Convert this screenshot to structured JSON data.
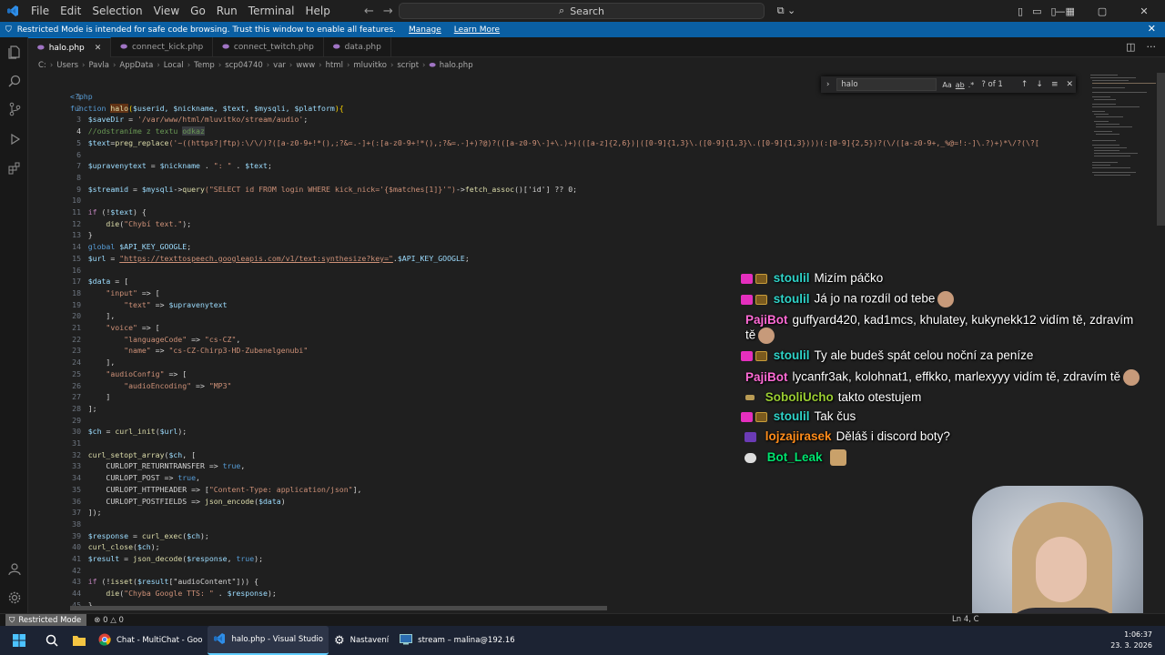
{
  "menu": [
    "File",
    "Edit",
    "Selection",
    "View",
    "Go",
    "Run",
    "Terminal",
    "Help"
  ],
  "search": {
    "label": "Search"
  },
  "banner": {
    "text": "Restricted Mode is intended for safe code browsing. Trust this window to enable all features.",
    "manage": "Manage",
    "learn_more": "Learn More"
  },
  "tabs": [
    {
      "label": "halo.php",
      "active": true
    },
    {
      "label": "connect_kick.php"
    },
    {
      "label": "connect_twitch.php"
    },
    {
      "label": "data.php"
    }
  ],
  "breadcrumb": [
    "C:",
    "Users",
    "Pavla",
    "AppData",
    "Local",
    "Temp",
    "scp04740",
    "var",
    "www",
    "html",
    "mluvitko",
    "script",
    "halo.php"
  ],
  "find": {
    "query": "halo",
    "count": "? of 1",
    "opt_case": "Aa",
    "opt_word": "ab",
    "opt_regex": ".*"
  },
  "code": {
    "l1": "<?php",
    "l2a": "function ",
    "l2b": "halo",
    "l2c": "(",
    "l2d": "$userid, $nickname, $text, $mysqli, $platform",
    "l2e": "){",
    "l3a": "    $saveDir",
    "l3b": " = ",
    "l3c": "'/var/www/html/mluvitko/stream/audio'",
    "l3d": ";",
    "l4a": "    //odstraníme z textu ",
    "l4b": "odkaz",
    "l5a": "    $text",
    "l5b": "=",
    "l5c": "preg_replace",
    "l5d": "('~((https?|ftp):\\/\\/)?([a-z0-9+!*(),;?&=.-]+(:[a-z0-9+!*(),;?&=.-]+)?@)?(([a-z0-9\\-]+\\.)+)(([a-z]{2,6})|([0-9]{1,3}\\.([0-9]{1,3}\\.([0-9]{1,3})))(:[0-9]{2,5})?(\\/([a-z0-9+,_%@=!:-]\\.?)+)*\\/?(\\?[",
    "l7a": "    $upravenytext",
    "l7b": " = ",
    "l7c": "$nickname",
    "l7d": " . ",
    "l7e": "\": \"",
    "l7f": " . ",
    "l7g": "$text",
    "l7h": ";",
    "l9a": "    $streamid",
    "l9b": " = ",
    "l9c": "$mysqli",
    "l9d": "->",
    "l9e": "query",
    "l9f": "(\"SELECT id FROM login WHERE kick_nick='{$matches[1]}'\")",
    "l9g": "->",
    "l9h": "fetch_assoc",
    "l9i": "()['id'] ?? 0;",
    "l11a": "    if ",
    "l11b": "(!",
    "l11c": "$text",
    "l11d": ") {",
    "l12a": "        die",
    "l12b": "(",
    "l12c": "\"Chybí text.\"",
    "l12d": ");",
    "l13": "    }",
    "l14a": "    global ",
    "l14b": "$API_KEY_GOOGLE",
    "l14c": ";",
    "l15a": "    $url",
    "l15b": " = ",
    "l15c": "\"https://texttospeech.googleapis.com/v1/text:synthesize?key=\"",
    "l15d": ".",
    "l15e": "$API_KEY_GOOGLE",
    "l15f": ";",
    "l17a": "    $data",
    "l17b": " = [",
    "l18a": "        \"input\"",
    "l18b": " => [",
    "l19a": "            \"text\"",
    "l19b": " => ",
    "l19c": "$upravenytext",
    "l20": "        ],",
    "l21a": "        \"voice\"",
    "l21b": " => [",
    "l22a": "            \"languageCode\"",
    "l22b": " => ",
    "l22c": "\"cs-CZ\"",
    "l22d": ",",
    "l23a": "            \"name\"",
    "l23b": " => ",
    "l23c": "\"cs-CZ-Chirp3-HD-Zubenelgenubi\"",
    "l24": "        ],",
    "l25a": "        \"audioConfig\"",
    "l25b": " => [",
    "l26a": "            \"audioEncoding\"",
    "l26b": " => ",
    "l26c": "\"MP3\"",
    "l27": "        ]",
    "l28": "    ];",
    "l30a": "    $ch",
    "l30b": " = ",
    "l30c": "curl_init",
    "l30d": "(",
    "l30e": "$url",
    "l30f": ");",
    "l32a": "    curl_setopt_array",
    "l32b": "(",
    "l32c": "$ch",
    "l32d": ", [",
    "l33a": "        CURLOPT_RETURNTRANSFER",
    "l33b": " => ",
    "l33c": "true",
    "l33d": ",",
    "l34a": "        CURLOPT_POST",
    "l34b": " => ",
    "l34c": "true",
    "l34d": ",",
    "l35a": "        CURLOPT_HTTPHEADER",
    "l35b": " => [",
    "l35c": "\"Content-Type: application/json\"",
    "l35d": "],",
    "l36a": "        CURLOPT_POSTFIELDS",
    "l36b": " => ",
    "l36c": "json_encode",
    "l36d": "(",
    "l36e": "$data",
    "l36f": ")",
    "l37": "    ]);",
    "l39a": "    $response",
    "l39b": " = ",
    "l39c": "curl_exec",
    "l39d": "(",
    "l39e": "$ch",
    "l39f": ");",
    "l40a": "    curl_close",
    "l40b": "(",
    "l40c": "$ch",
    "l40d": ");",
    "l41a": "    $result",
    "l41b": " = ",
    "l41c": "json_decode",
    "l41d": "(",
    "l41e": "$response",
    "l41f": ", ",
    "l41g": "true",
    "l41h": ");",
    "l43a": "    if ",
    "l43b": "(!",
    "l43c": "isset",
    "l43d": "(",
    "l43e": "$result",
    "l43f": "[\"audioContent\"])) {",
    "l44a": "        die",
    "l44b": "(",
    "l44c": "\"Chyba Google TTS: \"",
    "l44d": " . ",
    "l44e": "$response",
    "l44f": ");",
    "l45": "    }"
  },
  "chat": [
    {
      "nick": "stoulil",
      "text": "Mizím páčko",
      "nick_color": "#2fd3c8"
    },
    {
      "nick": "stoulil",
      "text": "Já jo na rozdíl od tebe",
      "nick_color": "#2fd3c8"
    },
    {
      "nick": "PajiBot",
      "text": "guffyard420, kad1mcs, khulatey, kukynekk12 vidím tě, zdravím",
      "cont": "tě",
      "nick_color": "#ff6bd6"
    },
    {
      "nick": "stoulil",
      "text": "Ty ale budeš spát celou noční za peníze",
      "nick_color": "#2fd3c8"
    },
    {
      "nick": "PajiBot",
      "text": "lycanfr3ak, kolohnat1, effkko, marlexyyy vidím tě, zdravím tě",
      "nick_color": "#ff6bd6"
    },
    {
      "nick": "SoboliUcho",
      "text": "takto otestujem",
      "nick_color": "#9acd32"
    },
    {
      "nick": "stoulil",
      "text": "Tak čus",
      "nick_color": "#2fd3c8"
    },
    {
      "nick": "lojzajirasek",
      "text": "Děláš i discord boty?",
      "nick_color": "#ff8c1a"
    },
    {
      "nick": "Bot_Leak",
      "text": "",
      "nick_color": "#00e36f"
    }
  ],
  "status": {
    "restricted": "Restricted Mode",
    "errors": "0",
    "warnings": "0",
    "position": "Ln 4, C"
  },
  "taskbar": {
    "apps": [
      {
        "label": "Chat - MultiChat - Goo"
      },
      {
        "label": "halo.php - Visual Studio",
        "active": true
      },
      {
        "label": "Nastavení"
      },
      {
        "label": "stream – malina@192.16"
      }
    ],
    "time": "1:06:37",
    "date": "23. 3. 2026"
  },
  "colors": {
    "accent": "#0078d4",
    "banner": "#0a5fa3",
    "editor_bg": "#1f1f1f"
  }
}
